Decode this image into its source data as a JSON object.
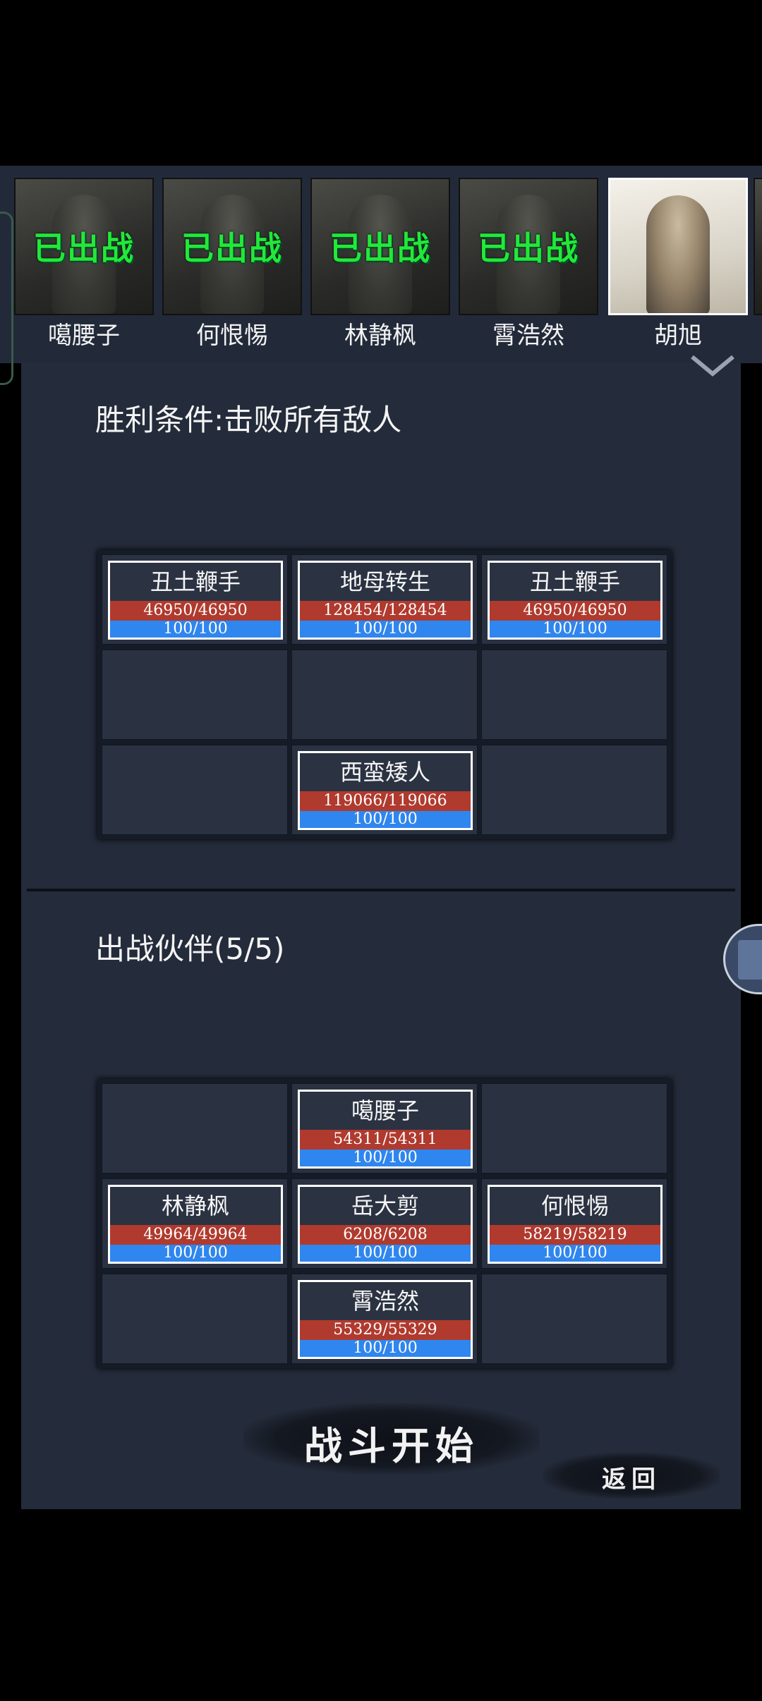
{
  "roster": {
    "deployed_label": "已出战",
    "heroes": [
      {
        "name": "噶腰子",
        "deployed": true
      },
      {
        "name": "何恨惕",
        "deployed": true
      },
      {
        "name": "林静枫",
        "deployed": true
      },
      {
        "name": "霄浩然",
        "deployed": true
      },
      {
        "name": "胡旭",
        "deployed": false
      }
    ]
  },
  "victory": {
    "title": "胜利条件:击败所有敌人"
  },
  "enemies": [
    {
      "name": "丑土鞭手",
      "hp": "46950/46950",
      "mp": "100/100"
    },
    {
      "name": "地母转生",
      "hp": "128454/128454",
      "mp": "100/100"
    },
    {
      "name": "丑土鞭手",
      "hp": "46950/46950",
      "mp": "100/100"
    },
    {
      "name": "西蛮矮人",
      "hp": "119066/119066",
      "mp": "100/100"
    }
  ],
  "party": {
    "title": "出战伙伴(5/5)",
    "members": [
      {
        "name": "噶腰子",
        "hp": "54311/54311",
        "mp": "100/100"
      },
      {
        "name": "林静枫",
        "hp": "49964/49964",
        "mp": "100/100"
      },
      {
        "name": "岳大剪",
        "hp": "6208/6208",
        "mp": "100/100"
      },
      {
        "name": "何恨惕",
        "hp": "58219/58219",
        "mp": "100/100"
      },
      {
        "name": "霄浩然",
        "hp": "55329/55329",
        "mp": "100/100"
      }
    ]
  },
  "buttons": {
    "start": "战斗开始",
    "back": "返回"
  },
  "colors": {
    "hp_bar": "#b03a2e",
    "mp_bar": "#2f86ee",
    "deployed_text": "#22e83a",
    "panel": "#242b3a"
  },
  "icons": [
    "chevron-down-icon",
    "side-tab-icon"
  ]
}
